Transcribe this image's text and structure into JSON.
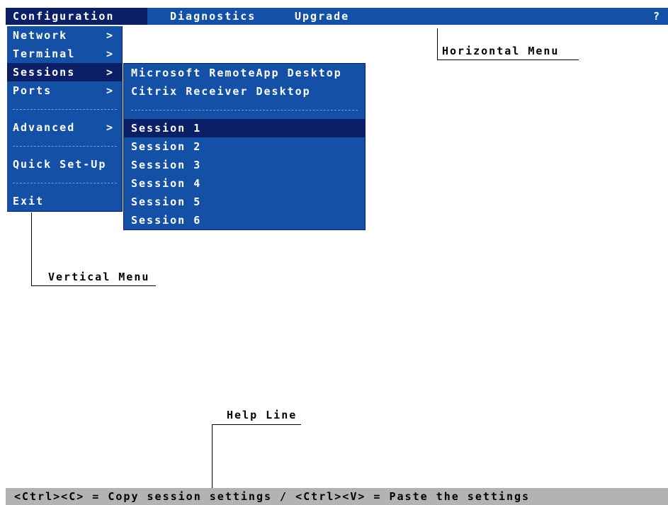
{
  "top_menu": {
    "items": [
      {
        "label": "Configuration"
      },
      {
        "label": "Diagnostics"
      },
      {
        "label": "Upgrade"
      }
    ],
    "help_label": "?"
  },
  "vertical_menu": {
    "items": [
      {
        "label": "Network",
        "arrow": ">"
      },
      {
        "label": "Terminal",
        "arrow": ">"
      },
      {
        "label": "Sessions",
        "arrow": ">"
      },
      {
        "label": "Ports",
        "arrow": ">"
      },
      {
        "label": "Advanced",
        "arrow": ">"
      },
      {
        "label": "Quick Set-Up"
      },
      {
        "label": "Exit"
      }
    ]
  },
  "sessions_submenu": {
    "items": [
      {
        "label": "Microsoft RemoteApp Desktop"
      },
      {
        "label": "Citrix Receiver Desktop"
      },
      {
        "label": "Session 1"
      },
      {
        "label": "Session 2"
      },
      {
        "label": "Session 3"
      },
      {
        "label": "Session 4"
      },
      {
        "label": "Session 5"
      },
      {
        "label": "Session 6"
      }
    ]
  },
  "callouts": {
    "horizontal_menu": "Horizontal Menu",
    "vertical_menu": "Vertical Menu",
    "help_line": "Help Line"
  },
  "help_line": {
    "text": "<Ctrl><C> = Copy session settings /  <Ctrl><V> = Paste the settings"
  },
  "colors": {
    "menu_bg": "#1451a6",
    "menu_selected": "#0b1f66",
    "help_bg": "#b3b3b3"
  }
}
